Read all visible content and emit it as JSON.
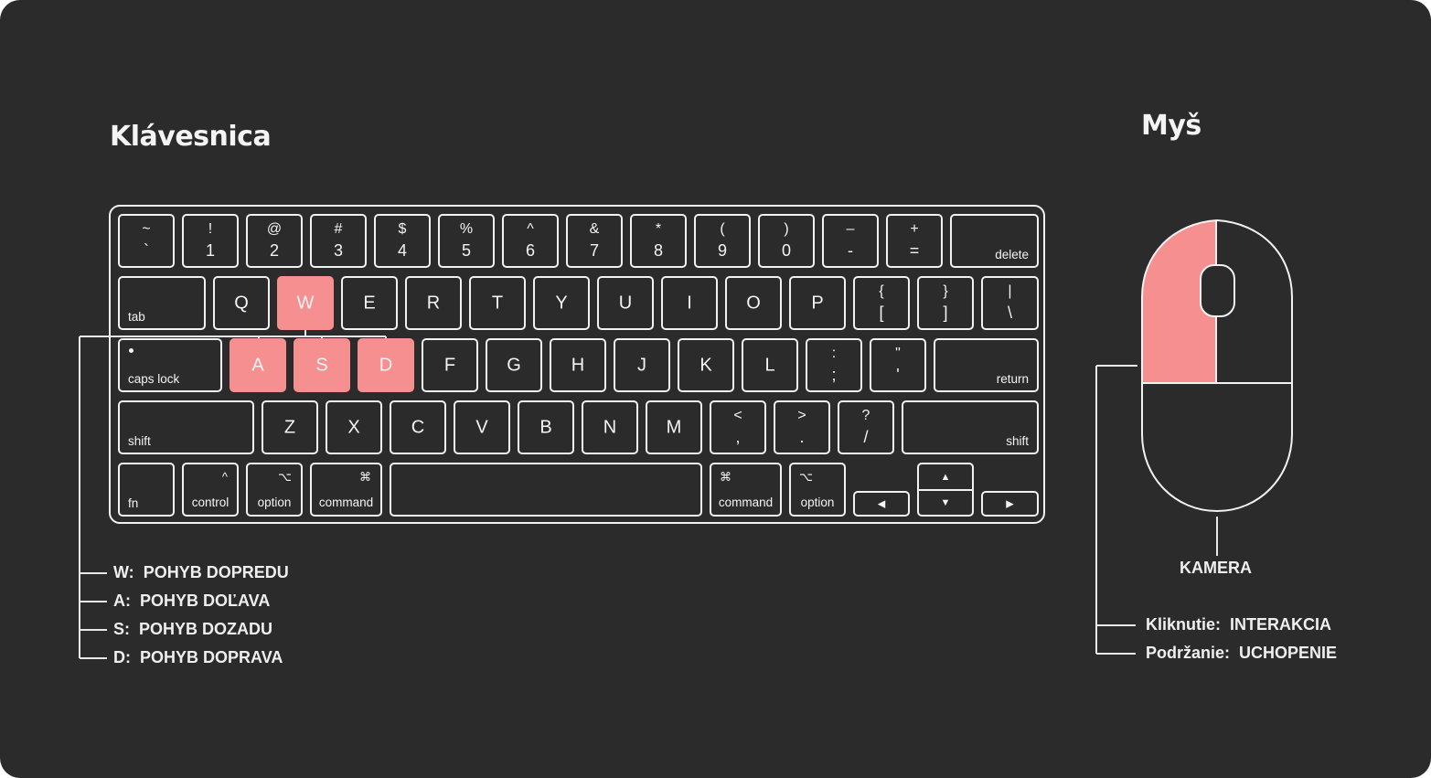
{
  "keyboard_title": "Klávesnica",
  "mouse_title": "Myš",
  "keys": {
    "tilde": {
      "top": "~",
      "bottom": "`"
    },
    "k1": {
      "top": "!",
      "bottom": "1"
    },
    "k2": {
      "top": "@",
      "bottom": "2"
    },
    "k3": {
      "top": "#",
      "bottom": "3"
    },
    "k4": {
      "top": "$",
      "bottom": "4"
    },
    "k5": {
      "top": "%",
      "bottom": "5"
    },
    "k6": {
      "top": "^",
      "bottom": "6"
    },
    "k7": {
      "top": "&",
      "bottom": "7"
    },
    "k8": {
      "top": "*",
      "bottom": "8"
    },
    "k9": {
      "top": "(",
      "bottom": "9"
    },
    "k0": {
      "top": ")",
      "bottom": "0"
    },
    "minus": {
      "top": "–",
      "bottom": "-"
    },
    "equal": {
      "top": "+",
      "bottom": "="
    },
    "delete": "delete",
    "tab": "tab",
    "q": "Q",
    "w": "W",
    "e": "E",
    "r": "R",
    "t": "T",
    "y": "Y",
    "u": "U",
    "i": "I",
    "o": "O",
    "p": "P",
    "lbracket": {
      "top": "{",
      "bottom": "["
    },
    "rbracket": {
      "top": "}",
      "bottom": "]"
    },
    "backslash": {
      "top": "|",
      "bottom": "\\"
    },
    "capslock": "caps lock",
    "a": "A",
    "s": "S",
    "d": "D",
    "f": "F",
    "g": "G",
    "h": "H",
    "j": "J",
    "k": "K",
    "l": "L",
    "semicolon": {
      "top": ":",
      "bottom": ";"
    },
    "quote": {
      "top": "\"",
      "bottom": "'"
    },
    "return": "return",
    "shift_left": "shift",
    "z": "Z",
    "x": "X",
    "c": "C",
    "v": "V",
    "b": "B",
    "n": "N",
    "m": "M",
    "comma": {
      "top": "<",
      "bottom": ","
    },
    "period": {
      "top": ">",
      "bottom": "."
    },
    "slash": {
      "top": "?",
      "bottom": "/"
    },
    "shift_right": "shift",
    "fn": "fn",
    "control": {
      "symbol": "^",
      "label": "control"
    },
    "option_left": {
      "symbol": "⌥",
      "label": "option"
    },
    "command_left": {
      "symbol": "⌘",
      "label": "command"
    },
    "command_right": {
      "symbol": "⌘",
      "label": "command"
    },
    "option_right": {
      "symbol": "⌥",
      "label": "option"
    },
    "arrow_left": "◀",
    "arrow_up": "▲",
    "arrow_down": "▼",
    "arrow_right": "▶"
  },
  "highlight_color": "#f69090",
  "keyboard_legend": [
    {
      "key": "W:",
      "action": "POHYB DOPREDU"
    },
    {
      "key": "A:",
      "action": "POHYB DOĽAVA"
    },
    {
      "key": "S:",
      "action": "POHYB DOZADU"
    },
    {
      "key": "D:",
      "action": "POHYB DOPRAVA"
    }
  ],
  "mouse_legend": {
    "wheel": "KAMERA",
    "items": [
      {
        "key": "Kliknutie:",
        "action": "INTERAKCIA"
      },
      {
        "key": "Podržanie:",
        "action": "UCHOPENIE"
      }
    ]
  }
}
